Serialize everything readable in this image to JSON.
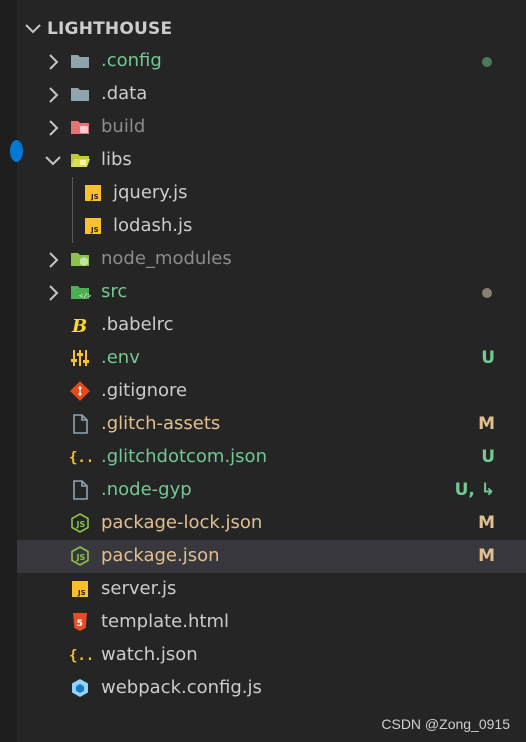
{
  "explorer": {
    "section_title": "LIGHTHOUSE",
    "rows": [
      {
        "label": ".config",
        "kind": "folder",
        "icon": "folder-config-icon",
        "color": "#73c991",
        "status": "",
        "dot": "#4b7a58"
      },
      {
        "label": ".data",
        "kind": "folder",
        "icon": "folder-icon",
        "color": "#cccccc",
        "status": "",
        "dot": ""
      },
      {
        "label": "build",
        "kind": "folder",
        "icon": "folder-build-icon",
        "color": "#8c8c8c",
        "status": "",
        "dot": ""
      },
      {
        "label": "libs",
        "kind": "folder-open",
        "icon": "folder-libs-open-icon",
        "color": "#cccccc",
        "status": "",
        "dot": ""
      },
      {
        "label": "jquery.js",
        "kind": "file",
        "icon": "javascript-file-icon",
        "color": "#cccccc",
        "status": "",
        "dot": ""
      },
      {
        "label": "lodash.js",
        "kind": "file",
        "icon": "javascript-file-icon",
        "color": "#cccccc",
        "status": "",
        "dot": ""
      },
      {
        "label": "node_modules",
        "kind": "folder",
        "icon": "folder-node-icon",
        "color": "#8c8c8c",
        "status": "",
        "dot": ""
      },
      {
        "label": "src",
        "kind": "folder",
        "icon": "folder-src-icon",
        "color": "#73c991",
        "status": "",
        "dot": "#8a8070"
      },
      {
        "label": ".babelrc",
        "kind": "file",
        "icon": "babel-icon",
        "color": "#cccccc",
        "status": "",
        "dot": ""
      },
      {
        "label": ".env",
        "kind": "file",
        "icon": "env-settings-icon",
        "color": "#73c991",
        "status": "U",
        "dot": ""
      },
      {
        "label": ".gitignore",
        "kind": "file",
        "icon": "git-icon",
        "color": "#cccccc",
        "status": "",
        "dot": ""
      },
      {
        "label": ".glitch-assets",
        "kind": "file",
        "icon": "file-icon",
        "color": "#e2c08d",
        "status": "M",
        "dot": ""
      },
      {
        "label": ".glitchdotcom.json",
        "kind": "file",
        "icon": "json-icon",
        "color": "#73c991",
        "status": "U",
        "dot": ""
      },
      {
        "label": ".node-gyp",
        "kind": "file",
        "icon": "file-icon",
        "color": "#73c991",
        "status": "U, ↳",
        "dot": ""
      },
      {
        "label": "package-lock.json",
        "kind": "file",
        "icon": "nodejs-icon",
        "color": "#e2c08d",
        "status": "M",
        "dot": ""
      },
      {
        "label": "package.json",
        "kind": "file",
        "icon": "nodejs-icon",
        "color": "#e2c08d",
        "status": "M",
        "dot": ""
      },
      {
        "label": "server.js",
        "kind": "file",
        "icon": "javascript-file-icon",
        "color": "#cccccc",
        "status": "",
        "dot": ""
      },
      {
        "label": "template.html",
        "kind": "file",
        "icon": "html5-icon",
        "color": "#cccccc",
        "status": "",
        "dot": ""
      },
      {
        "label": "watch.json",
        "kind": "file",
        "icon": "json-icon",
        "color": "#cccccc",
        "status": "",
        "dot": ""
      },
      {
        "label": "webpack.config.js",
        "kind": "file",
        "icon": "webpack-icon",
        "color": "#cccccc",
        "status": "",
        "dot": ""
      }
    ],
    "selected_label": "package.json",
    "colors": {
      "untracked": "#73c991",
      "modified": "#e2c08d",
      "ignored": "#8c8c8c"
    }
  },
  "watermark": "CSDN @Zong_0915"
}
